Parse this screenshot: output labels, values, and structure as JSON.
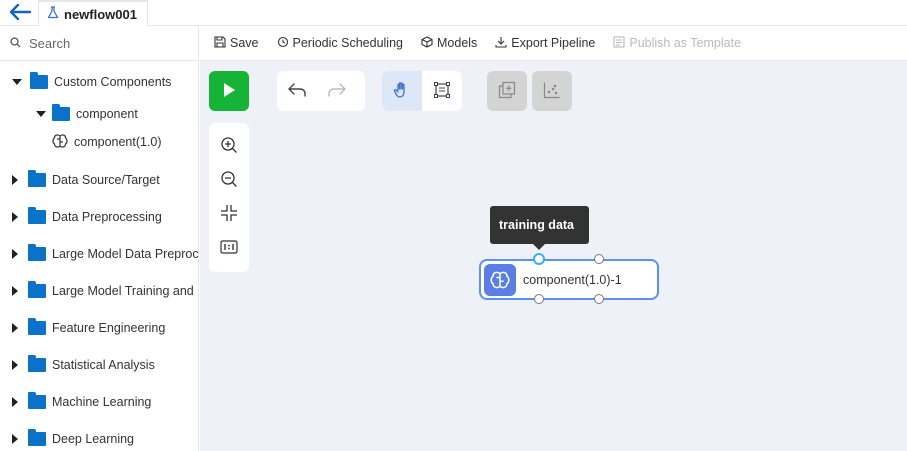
{
  "header": {
    "tab_title": "newflow001"
  },
  "sidebar": {
    "search_placeholder": "Search",
    "items": [
      {
        "label": "Custom Components",
        "expanded": true
      },
      {
        "label": "component",
        "expanded": true
      },
      {
        "label": "component(1.0)"
      },
      {
        "label": "Data Source/Target"
      },
      {
        "label": "Data Preprocessing"
      },
      {
        "label": "Large Model Data Preproce"
      },
      {
        "label": "Large Model Training and Ir"
      },
      {
        "label": "Feature Engineering"
      },
      {
        "label": "Statistical Analysis"
      },
      {
        "label": "Machine Learning"
      },
      {
        "label": "Deep Learning"
      }
    ]
  },
  "toolbar": {
    "save": "Save",
    "periodic_scheduling": "Periodic Scheduling",
    "models": "Models",
    "export_pipeline": "Export Pipeline",
    "publish_template": "Publish as Template"
  },
  "canvas": {
    "tooltip": "training data",
    "node_label": "component(1.0)-1"
  },
  "colors": {
    "accent": "#5b8ff9",
    "run": "#16b436",
    "folder": "#0a72c9",
    "back": "#1565c0"
  }
}
